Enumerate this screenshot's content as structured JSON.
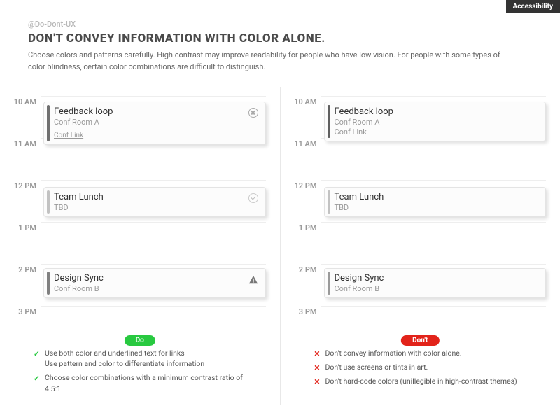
{
  "badge": "Accessibility",
  "handle": "@Do-Dont-UX",
  "title": "DON'T CONVEY INFORMATION WITH COLOR ALONE.",
  "description": "Choose colors and patterns carefully. High contrast may improve readability for people who have low vision. For people with some types of color blindness, certain color combinations are difficult to distinguish.",
  "times": [
    "10 AM",
    "11 AM",
    "12 PM",
    "1 PM",
    "2 PM",
    "3 PM"
  ],
  "events": [
    {
      "title": "Feedback loop",
      "room": "Conf Room A",
      "link": "Conf Link"
    },
    {
      "title": "Team Lunch",
      "room": "TBD"
    },
    {
      "title": "Design Sync",
      "room": "Conf Room B"
    }
  ],
  "pill_do": "Do",
  "pill_dont": "Don't",
  "do_list": [
    "Use both color and underlined text for links",
    "Use pattern and color to differentiate information",
    "Choose color combinations with a minimum contrast ratio of 4.5:1."
  ],
  "dont_list": [
    "Don't convey information with color alone.",
    "Don't use screens or tints in art.",
    "Don't hard-code colors (unillegible in high-contrast themes)"
  ]
}
